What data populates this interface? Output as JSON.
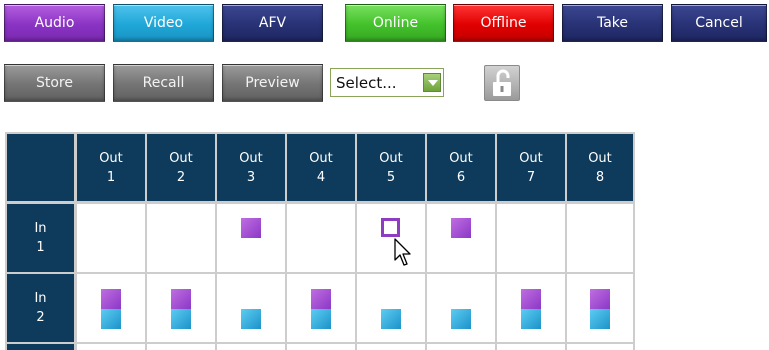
{
  "toolbar": {
    "audio": "Audio",
    "video": "Video",
    "afv": "AFV",
    "online": "Online",
    "offline": "Offline",
    "take": "Take",
    "cancel": "Cancel"
  },
  "presets": {
    "store": "Store",
    "recall": "Recall",
    "preview": "Preview",
    "select_value": "Select..."
  },
  "lock_icon": "unlock-icon",
  "colors": {
    "header": "#0e3b5c",
    "audio": "#8a33c4",
    "video": "#1fa7d8",
    "navy": "#283275",
    "online": "#43c12b",
    "offline": "#e00000",
    "gray": "#747474"
  },
  "matrix": {
    "outputs": [
      {
        "word": "Out",
        "num": "1"
      },
      {
        "word": "Out",
        "num": "2"
      },
      {
        "word": "Out",
        "num": "3"
      },
      {
        "word": "Out",
        "num": "4"
      },
      {
        "word": "Out",
        "num": "5"
      },
      {
        "word": "Out",
        "num": "6"
      },
      {
        "word": "Out",
        "num": "7"
      },
      {
        "word": "Out",
        "num": "8"
      }
    ],
    "inputs": [
      {
        "word": "In",
        "num": "1"
      },
      {
        "word": "In",
        "num": "2"
      }
    ],
    "crosspoints": [
      [
        "none",
        "none",
        "audio",
        "none",
        "hover",
        "audio",
        "none",
        "none"
      ],
      [
        "audio+video",
        "audio+video",
        "video",
        "audio+video",
        "video",
        "video",
        "audio+video",
        "audio+video"
      ]
    ]
  }
}
